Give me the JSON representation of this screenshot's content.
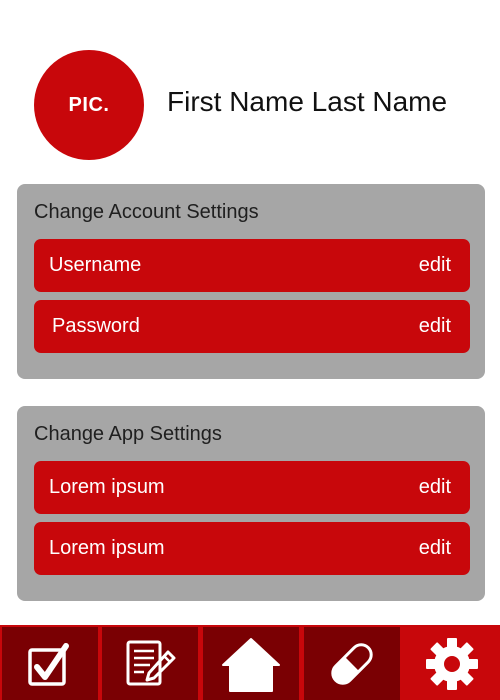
{
  "profile": {
    "avatar_text": "PIC.",
    "name": "First Name Last Name"
  },
  "account_settings": {
    "title": "Change Account Settings",
    "items": [
      {
        "label": "Username",
        "action": "edit"
      },
      {
        "label": "Password",
        "action": "edit"
      }
    ]
  },
  "app_settings": {
    "title": "Change App Settings",
    "items": [
      {
        "label": "Lorem ipsum",
        "action": "edit"
      },
      {
        "label": "Lorem ipsum",
        "action": "edit"
      }
    ]
  },
  "nav": {
    "items": [
      {
        "icon": "checkbox-icon",
        "active": false
      },
      {
        "icon": "notes-edit-icon",
        "active": false
      },
      {
        "icon": "home-icon",
        "active": false
      },
      {
        "icon": "pill-icon",
        "active": false
      },
      {
        "icon": "gear-icon",
        "active": true
      }
    ]
  },
  "colors": {
    "accent": "#c8070b",
    "nav_inactive": "#7a0003",
    "panel": "#a6a6a6"
  }
}
